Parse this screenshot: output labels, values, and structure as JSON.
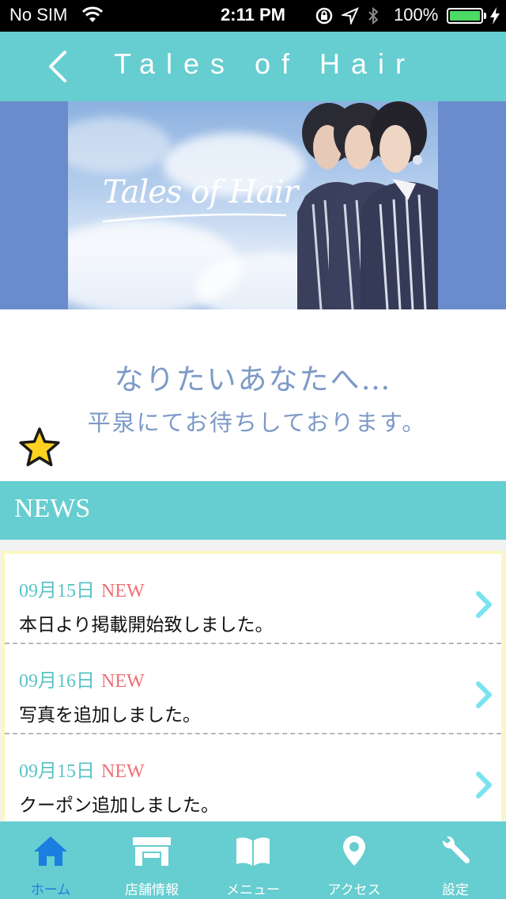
{
  "status_bar": {
    "carrier": "No SIM",
    "time": "2:11 PM",
    "battery_percent": "100%",
    "battery_color": "#4cd964"
  },
  "navbar": {
    "title": "Tales of Hair",
    "back_icon": "chevron-left-icon",
    "color": "#66cdd0"
  },
  "hero": {
    "logo_text": "Tales of Hair"
  },
  "slogan": {
    "line1": "なりたいあなたへ…",
    "line2": "平泉にてお待ちしております。"
  },
  "news": {
    "header": "NEWS",
    "items": [
      {
        "date": "09月15日",
        "badge": "NEW",
        "text": "本日より掲載開始致しました。"
      },
      {
        "date": "09月16日",
        "badge": "NEW",
        "text": "写真を追加しました。"
      },
      {
        "date": "09月15日",
        "badge": "NEW",
        "text": "クーポン追加しました。"
      }
    ]
  },
  "tabbar": {
    "active_color": "#1a7fe0",
    "tabs": [
      {
        "label": "ホーム",
        "icon": "home-icon",
        "active": true
      },
      {
        "label": "店舗情報",
        "icon": "store-icon",
        "active": false
      },
      {
        "label": "メニュー",
        "icon": "book-icon",
        "active": false
      },
      {
        "label": "アクセス",
        "icon": "location-pin-icon",
        "active": false
      },
      {
        "label": "設定",
        "icon": "wrench-icon",
        "active": false
      }
    ]
  }
}
